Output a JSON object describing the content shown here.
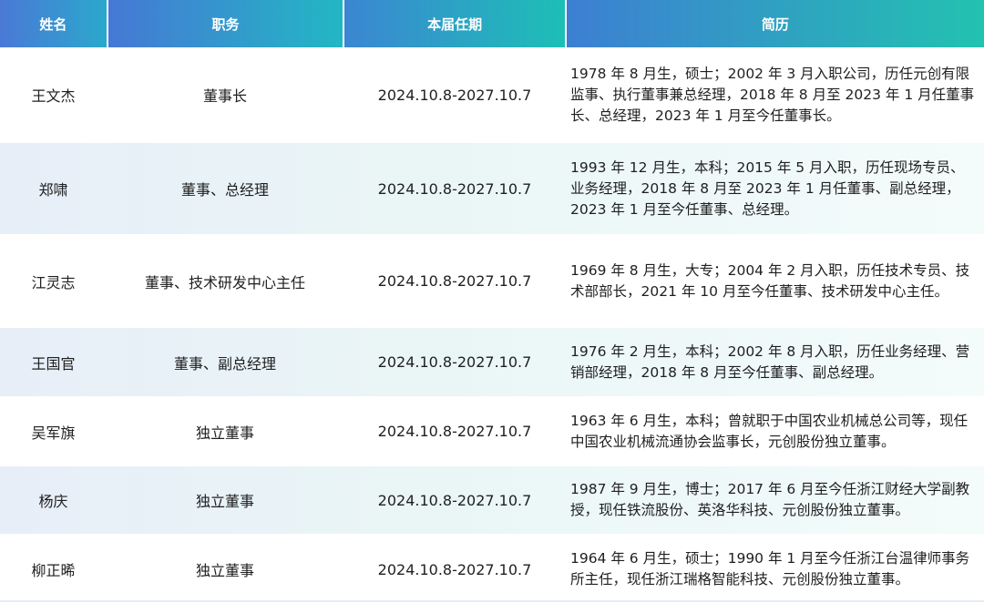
{
  "header": {
    "name": "姓名",
    "position": "职务",
    "term": "本届任期",
    "resume": "简历"
  },
  "rows": [
    {
      "name": "王文杰",
      "position": "董事长",
      "term": "2024.10.8-2027.10.7",
      "resume": "1978 年 8 月生，硕士；2002 年 3 月入职公司，历任元创有限监事、执行董事兼总经理，2018 年 8 月至 2023 年 1 月任董事长、总经理，2023 年 1 月至今任董事长。"
    },
    {
      "name": "郑啸",
      "position": "董事、总经理",
      "term": "2024.10.8-2027.10.7",
      "resume": "1993 年 12 月生，本科；2015 年 5 月入职，历任现场专员、业务经理，2018 年 8 月至 2023 年 1 月任董事、副总经理，2023 年 1 月至今任董事、总经理。"
    },
    {
      "name": "江灵志",
      "position": "董事、技术研发中心主任",
      "term": "2024.10.8-2027.10.7",
      "resume": "1969 年 8 月生，大专；2004 年 2 月入职，历任技术专员、技术部部长，2021 年 10 月至今任董事、技术研发中心主任。"
    },
    {
      "name": "王国官",
      "position": "董事、副总经理",
      "term": "2024.10.8-2027.10.7",
      "resume": "1976 年 2 月生，本科；2002 年 8 月入职，历任业务经理、营销部经理，2018 年 8 月至今任董事、副总经理。"
    },
    {
      "name": "吴军旗",
      "position": "独立董事",
      "term": "2024.10.8-2027.10.7",
      "resume": "1963 年 6 月生，本科；曾就职于中国农业机械总公司等，现任中国农业机械流通协会监事长，元创股份独立董事。"
    },
    {
      "name": "杨庆",
      "position": "独立董事",
      "term": "2024.10.8-2027.10.7",
      "resume": "1987 年 9 月生，博士；2017 年 6 月至今任浙江财经大学副教授，现任铁流股份、英洛华科技、元创股份独立董事。"
    },
    {
      "name": "柳正晞",
      "position": "独立董事",
      "term": "2024.10.8-2027.10.7",
      "resume": "1964 年 6 月生，硕士；1990 年 1 月至今任浙江台温律师事务所主任，现任浙江瑞格智能科技、元创股份独立董事。"
    }
  ]
}
